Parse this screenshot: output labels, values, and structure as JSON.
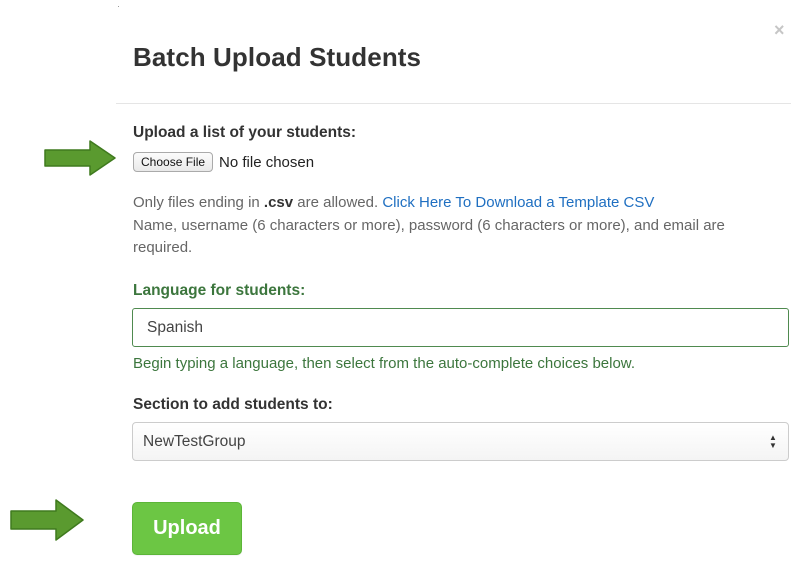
{
  "modal": {
    "title": "Batch Upload Students",
    "close_glyph": "×"
  },
  "file_upload": {
    "label": "Upload a list of your students:",
    "button_label": "Choose File",
    "status": "No file chosen",
    "help_prefix": "Only files ending in ",
    "help_ext": ".csv",
    "help_mid": " are allowed. ",
    "template_link": "Click Here To Download a Template CSV",
    "requirements": "Name, username (6 characters or more), password (6 characters or more), and email are required."
  },
  "language": {
    "label": "Language for students:",
    "value": "Spanish",
    "help": "Begin typing a language, then select from the auto-complete choices below."
  },
  "section": {
    "label": "Section to add students to:",
    "selected": "NewTestGroup"
  },
  "actions": {
    "upload_label": "Upload"
  },
  "icons": {
    "arrow": "right-arrow-icon",
    "select": "select-arrows-icon",
    "close": "close-icon"
  },
  "colors": {
    "arrow": "#5a9a2f",
    "upload_button": "#6cc644",
    "success_text": "#3c763d",
    "link": "#1f6fc1"
  }
}
